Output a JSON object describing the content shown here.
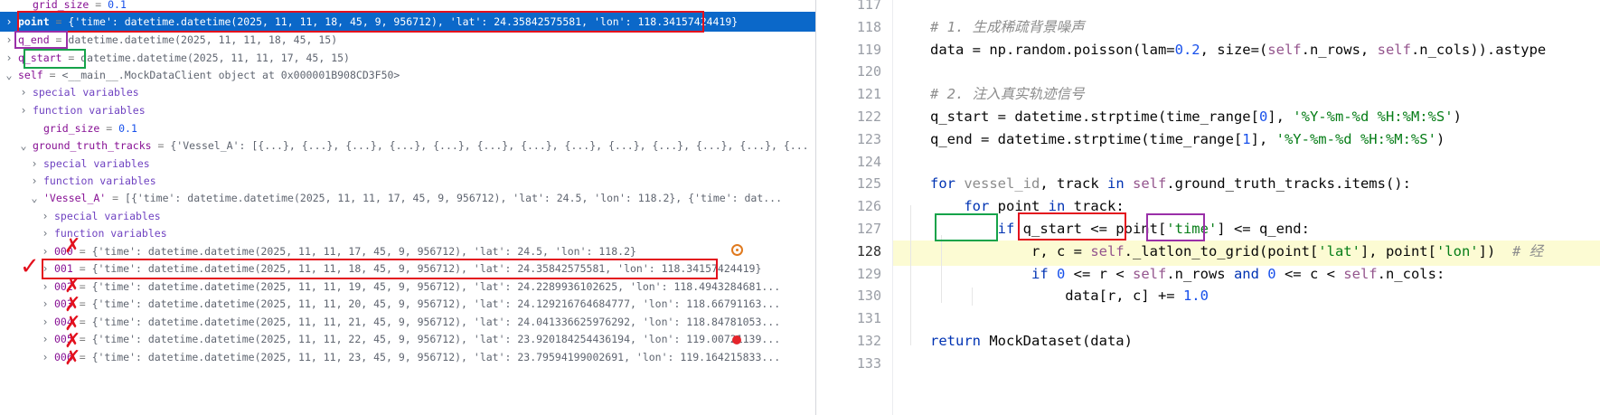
{
  "debugger": {
    "rows": [
      {
        "name": "grid_size",
        "sep": " = ",
        "value": "0.1",
        "arrow": ""
      },
      {
        "name": "point",
        "sep": " = ",
        "value": "{'time': datetime.datetime(2025, 11, 11, 18, 45, 9, 956712), 'lat': 24.35842575581, 'lon': 118.34157424419}",
        "arrow": "›"
      },
      {
        "name": "q_end",
        "sep": " = ",
        "value": "datetime.datetime(2025, 11, 11, 18, 45, 15)",
        "arrow": "›"
      },
      {
        "name": "q_start",
        "sep": " = ",
        "value": "datetime.datetime(2025, 11, 11, 17, 45, 15)",
        "arrow": "›"
      },
      {
        "name": "self",
        "sep": " = ",
        "value": "<__main__.MockDataClient object at 0x000001B908CD3F50>",
        "arrow": "⌄"
      },
      {
        "name": "special variables",
        "sep": "",
        "value": "",
        "arrow": "›"
      },
      {
        "name": "function variables",
        "sep": "",
        "value": "",
        "arrow": "›"
      },
      {
        "name": "grid_size",
        "sep": " = ",
        "value": "0.1",
        "arrow": ""
      },
      {
        "name": "ground_truth_tracks",
        "sep": " = ",
        "value": "{'Vessel_A': [{...}, {...}, {...}, {...}, {...}, {...}, {...}, {...}, {...}, {...}, {...}, {...}, {...",
        "arrow": "⌄"
      },
      {
        "name": "special variables",
        "sep": "",
        "value": "",
        "arrow": "›"
      },
      {
        "name": "function variables",
        "sep": "",
        "value": "",
        "arrow": "›"
      },
      {
        "name": "'Vessel_A'",
        "sep": " = ",
        "value": "[{'time': datetime.datetime(2025, 11, 11, 17, 45, 9, 956712), 'lat': 24.5, 'lon': 118.2}, {'time': dat...",
        "arrow": "⌄"
      },
      {
        "name": "special variables",
        "sep": "",
        "value": "",
        "arrow": "›"
      },
      {
        "name": "function variables",
        "sep": "",
        "value": "",
        "arrow": "›"
      },
      {
        "name": "000",
        "sep": " = ",
        "value": "{'time': datetime.datetime(2025, 11, 11, 17, 45, 9, 956712), 'lat': 24.5, 'lon': 118.2}",
        "arrow": "›"
      },
      {
        "name": "001",
        "sep": " = ",
        "value": "{'time': datetime.datetime(2025, 11, 11, 18, 45, 9, 956712), 'lat': 24.35842575581, 'lon': 118.34157424419}",
        "arrow": "›"
      },
      {
        "name": "002",
        "sep": " = ",
        "value": "{'time': datetime.datetime(2025, 11, 11, 19, 45, 9, 956712), 'lat': 24.2289936102625, 'lon': 118.4943284681...",
        "arrow": "›"
      },
      {
        "name": "003",
        "sep": " = ",
        "value": "{'time': datetime.datetime(2025, 11, 11, 20, 45, 9, 956712), 'lat': 24.129216764684777, 'lon': 118.66791163...",
        "arrow": "›"
      },
      {
        "name": "004",
        "sep": " = ",
        "value": "{'time': datetime.datetime(2025, 11, 11, 21, 45, 9, 956712), 'lat': 24.041336625976292, 'lon': 118.84781053...",
        "arrow": "›"
      },
      {
        "name": "005",
        "sep": " = ",
        "value": "{'time': datetime.datetime(2025, 11, 11, 22, 45, 9, 956712), 'lat': 23.920184254436194, 'lon': 119.00721139...",
        "arrow": "›"
      },
      {
        "name": "006",
        "sep": " = ",
        "value": "{'time': datetime.datetime(2025, 11, 11, 23, 45, 9, 956712), 'lat': 23.79594199002691, 'lon': 119.164215833...",
        "arrow": "›"
      }
    ]
  },
  "editor": {
    "line_numbers": [
      "117",
      "118",
      "119",
      "120",
      "121",
      "122",
      "123",
      "124",
      "125",
      "126",
      "127",
      "128",
      "129",
      "130",
      "131",
      "132",
      "133"
    ],
    "lines": [
      [],
      [
        {
          "t": "# 1. 生成稀疏背景噪声",
          "c": "c"
        }
      ],
      [
        {
          "t": "data = np.random.poisson(lam=",
          "c": ""
        },
        {
          "t": "0.2",
          "c": "cnum"
        },
        {
          "t": ", size=(",
          "c": ""
        },
        {
          "t": "self",
          "c": "self"
        },
        {
          "t": ".n_rows, ",
          "c": ""
        },
        {
          "t": "self",
          "c": "self"
        },
        {
          "t": ".n_cols)).astype",
          "c": ""
        }
      ],
      [],
      [
        {
          "t": "# 2. 注入真实轨迹信号",
          "c": "c"
        }
      ],
      [
        {
          "t": "q_start = datetime.strptime(time_range[",
          "c": ""
        },
        {
          "t": "0",
          "c": "cnum"
        },
        {
          "t": "], ",
          "c": ""
        },
        {
          "t": "'%Y-%m-%d %H:%M:%S'",
          "c": "str"
        },
        {
          "t": ")",
          "c": ""
        }
      ],
      [
        {
          "t": "q_end = datetime.strptime(time_range[",
          "c": ""
        },
        {
          "t": "1",
          "c": "cnum"
        },
        {
          "t": "], ",
          "c": ""
        },
        {
          "t": "'%Y-%m-%d %H:%M:%S'",
          "c": "str"
        },
        {
          "t": ")",
          "c": ""
        }
      ],
      [],
      [
        {
          "t": "for ",
          "c": "kw"
        },
        {
          "t": "vessel_id",
          "c": "gray"
        },
        {
          "t": ", track ",
          "c": ""
        },
        {
          "t": "in ",
          "c": "kw"
        },
        {
          "t": "self",
          "c": "self"
        },
        {
          "t": ".ground_truth_tracks.items():",
          "c": ""
        }
      ],
      [
        {
          "t": "    for ",
          "c": "kw"
        },
        {
          "t": "point ",
          "c": ""
        },
        {
          "t": "in ",
          "c": "kw"
        },
        {
          "t": "track:",
          "c": ""
        }
      ],
      [
        {
          "t": "        if ",
          "c": "kw"
        },
        {
          "t": "q_start <= point[",
          "c": ""
        },
        {
          "t": "'time'",
          "c": "str"
        },
        {
          "t": "] <= q_end:",
          "c": ""
        }
      ],
      [
        {
          "t": "            r, c = ",
          "c": ""
        },
        {
          "t": "self",
          "c": "self"
        },
        {
          "t": "._latlon_to_grid(point[",
          "c": ""
        },
        {
          "t": "'lat'",
          "c": "str"
        },
        {
          "t": "], point[",
          "c": ""
        },
        {
          "t": "'lon'",
          "c": "str"
        },
        {
          "t": "])  ",
          "c": ""
        },
        {
          "t": "# 经",
          "c": "c"
        }
      ],
      [
        {
          "t": "            if ",
          "c": "kw"
        },
        {
          "t": "0",
          "c": "cnum"
        },
        {
          "t": " <= r < ",
          "c": ""
        },
        {
          "t": "self",
          "c": "self"
        },
        {
          "t": ".n_rows ",
          "c": ""
        },
        {
          "t": "and ",
          "c": "kw"
        },
        {
          "t": "0",
          "c": "cnum"
        },
        {
          "t": " <= c < ",
          "c": ""
        },
        {
          "t": "self",
          "c": "self"
        },
        {
          "t": ".n_cols:",
          "c": ""
        }
      ],
      [
        {
          "t": "                data[r, c] += ",
          "c": ""
        },
        {
          "t": "1.0",
          "c": "cnum"
        }
      ],
      [],
      [
        {
          "t": "return ",
          "c": "kw"
        },
        {
          "t": "MockDataset(data)",
          "c": ""
        }
      ],
      []
    ]
  },
  "annotations": {
    "check_mark": "✓",
    "cross_mark": "✗"
  },
  "colors": {
    "selected_row": "#0b68c9",
    "highlight_line": "#fcfbd3",
    "box_red": "#e3101d",
    "box_purple": "#9a2fa8",
    "box_green": "#16a34a",
    "breakpoint": "#e5242b"
  }
}
